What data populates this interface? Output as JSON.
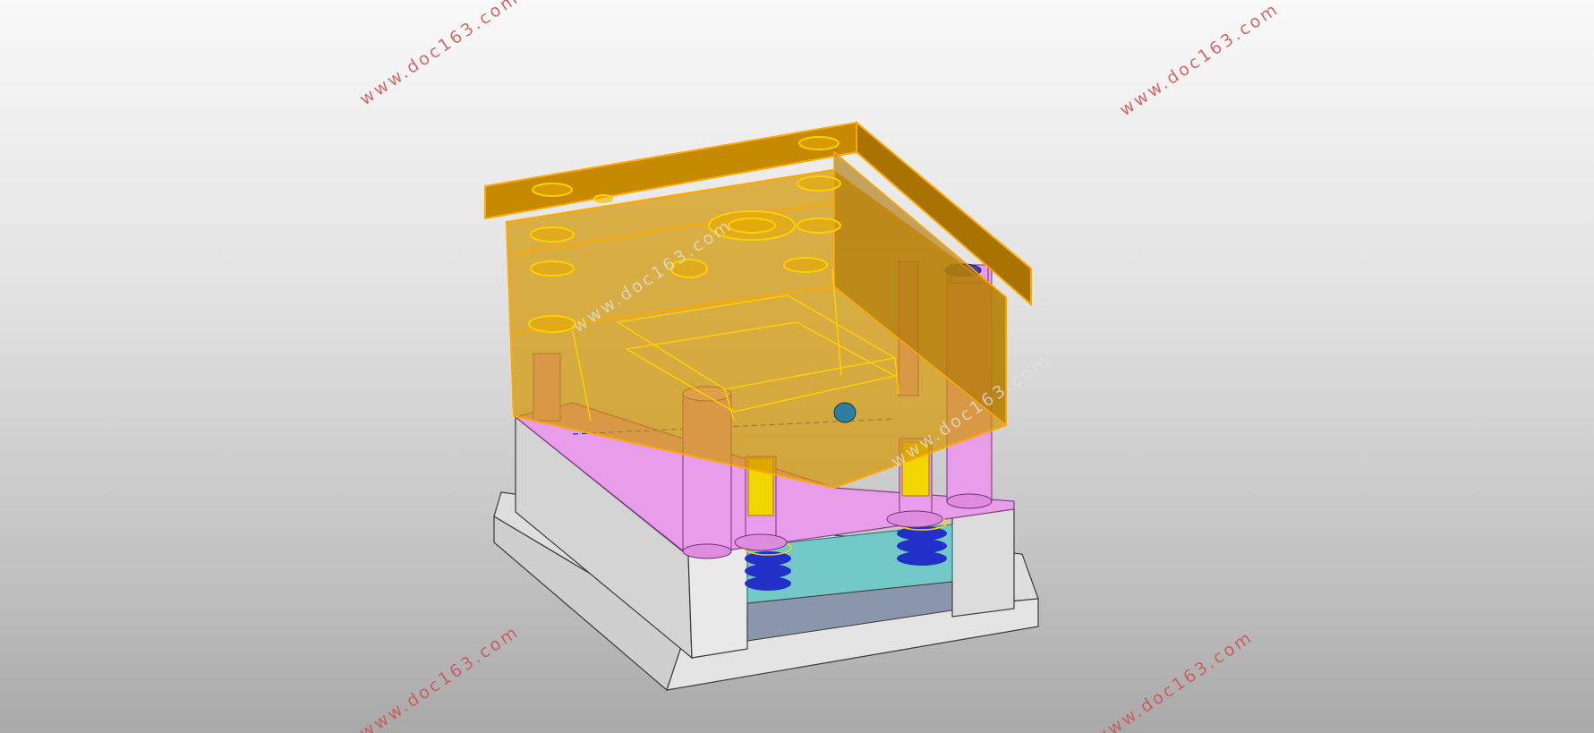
{
  "viewport": {
    "background_top": "#f9f9f9",
    "background_bottom": "#a9a9a9"
  },
  "model": {
    "colors": {
      "top_plate": "#c68a00",
      "top_plate_edge": "#ffa800",
      "mold_frame": "#e8e8e8",
      "mold_frame_edge": "#3a3a3a",
      "pin_plate": "#e79de9",
      "pin_plate_edge": "#8a3b8c",
      "ejector_plate": "#72c9c8",
      "base_slot": "#8a96ab",
      "spring": "#2330c8",
      "highlight": "#ffcf00"
    }
  },
  "watermarks": {
    "top_left": "www.doc163.com",
    "top_right": "www.doc163.com",
    "bottom_left": "www.doc163.com",
    "bottom_right": "www.doc163.com",
    "center_left": "www.doc163.com",
    "center_right": "www.doc163.com"
  }
}
